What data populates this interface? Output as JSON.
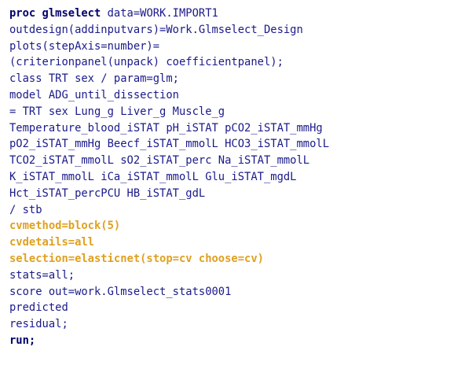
{
  "editor": {
    "lines": [
      {
        "parts": [
          {
            "t": "kw",
            "v": "proc glmselect"
          },
          {
            "t": "txt",
            "v": " data=WORK.IMPORT1"
          }
        ]
      },
      {
        "parts": [
          {
            "t": "txt",
            "v": "outdesign(addinputvars)=Work.Glmselect_Design"
          }
        ]
      },
      {
        "parts": [
          {
            "t": "txt",
            "v": "plots(stepAxis=number)="
          }
        ]
      },
      {
        "parts": [
          {
            "t": "txt",
            "v": "(criterionpanel(unpack) coefficientpanel);"
          }
        ]
      },
      {
        "parts": [
          {
            "t": "txt",
            "v": "class TRT sex / param=glm;"
          }
        ]
      },
      {
        "parts": [
          {
            "t": "txt",
            "v": "model ADG_until_dissection"
          }
        ]
      },
      {
        "parts": [
          {
            "t": "txt",
            "v": "= TRT sex Lung_g Liver_g Muscle_g"
          }
        ]
      },
      {
        "parts": [
          {
            "t": "txt",
            "v": "Temperature_blood_iSTAT pH_iSTAT pCO2_iSTAT_mmHg"
          }
        ]
      },
      {
        "parts": [
          {
            "t": "txt",
            "v": "pO2_iSTAT_mmHg Beecf_iSTAT_mmolL HCO3_iSTAT_mmolL"
          }
        ]
      },
      {
        "parts": [
          {
            "t": "txt",
            "v": "TCO2_iSTAT_mmolL sO2_iSTAT_perc Na_iSTAT_mmolL"
          }
        ]
      },
      {
        "parts": [
          {
            "t": "txt",
            "v": "K_iSTAT_mmolL iCa_iSTAT_mmolL Glu_iSTAT_mgdL"
          }
        ]
      },
      {
        "parts": [
          {
            "t": "txt",
            "v": "Hct_iSTAT_percPCU HB_iSTAT_gdL"
          }
        ]
      },
      {
        "parts": [
          {
            "t": "txt",
            "v": "/ stb"
          }
        ]
      },
      {
        "parts": [
          {
            "t": "opt",
            "v": "cvmethod=block(5)"
          }
        ]
      },
      {
        "parts": [
          {
            "t": "opt",
            "v": "cvdetails=all"
          }
        ]
      },
      {
        "parts": [
          {
            "t": "opt",
            "v": "selection=elasticnet(stop=cv choose=cv)"
          }
        ]
      },
      {
        "parts": [
          {
            "t": "txt",
            "v": "stats=all;"
          }
        ]
      },
      {
        "parts": [
          {
            "t": "txt",
            "v": "score out=work.Glmselect_stats0001"
          }
        ]
      },
      {
        "parts": [
          {
            "t": "txt",
            "v": "predicted"
          }
        ]
      },
      {
        "parts": [
          {
            "t": "txt",
            "v": "residual;"
          }
        ]
      },
      {
        "parts": [
          {
            "t": "kw",
            "v": "run;"
          }
        ]
      }
    ]
  },
  "colors": {
    "background": "#ffffff",
    "keyword": "#00006b",
    "text": "#1a1a8a",
    "highlight_option": "#e0a020"
  }
}
